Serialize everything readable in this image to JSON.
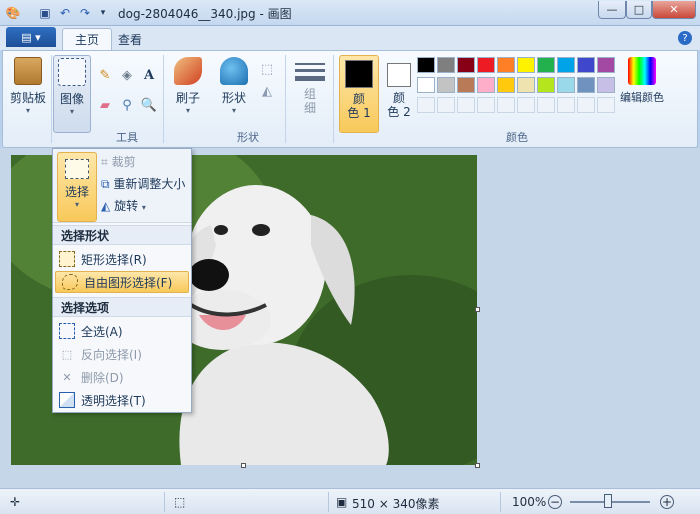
{
  "window": {
    "title": "dog-2804046__340.jpg - 画图",
    "minimize": "—",
    "maximize": "□",
    "close": "✕"
  },
  "quick_access": [
    "paint-app-icon",
    "save-icon",
    "undo-icon",
    "redo-icon",
    "customize-icon"
  ],
  "tabs": {
    "home": "主页",
    "view": "查看",
    "help": "?"
  },
  "ribbon": {
    "clipboard": {
      "label": "剪贴板"
    },
    "image": {
      "label": "图像"
    },
    "tools": {
      "label": "工具"
    },
    "brushes": {
      "label": "刷子"
    },
    "shapes_btn": {
      "label": "形状"
    },
    "shapes_group": {
      "label": "形状"
    },
    "outline": {
      "label": "组\n细"
    },
    "color1": {
      "label": "颜\n色 1"
    },
    "color2": {
      "label": "颜\n色 2"
    },
    "colors_group": {
      "label": "颜色"
    },
    "edit_colors": {
      "label": "编辑颜色"
    },
    "palette_row1": [
      "#000000",
      "#7f7f7f",
      "#880015",
      "#ed1c24",
      "#ff7f27",
      "#fff200",
      "#22b14c",
      "#00a2e8",
      "#3f48cc",
      "#a349a4"
    ],
    "palette_row2": [
      "#ffffff",
      "#c3c3c3",
      "#b97a57",
      "#ffaec9",
      "#ffc90e",
      "#efe4b0",
      "#b5e61d",
      "#99d9ea",
      "#7092be",
      "#c8bfe7"
    ]
  },
  "dropdown": {
    "select_btn": "选择",
    "crop": "裁剪",
    "resize": "重新调整大小",
    "rotate": "旋转",
    "section_shape": "选择形状",
    "rect_select": "矩形选择(R)",
    "free_select": "自由图形选择(F)",
    "section_options": "选择选项",
    "select_all": "全选(A)",
    "invert": "反向选择(I)",
    "delete": "删除(D)",
    "transparent": "透明选择(T)"
  },
  "status": {
    "dimensions": "510 × 340像素",
    "zoom": "100%"
  }
}
